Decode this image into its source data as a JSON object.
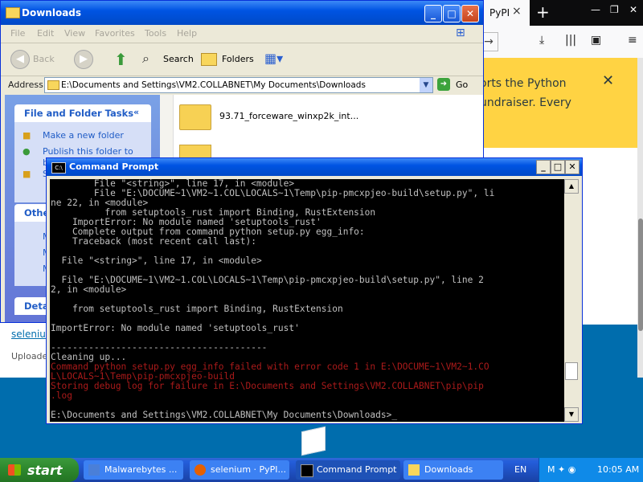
{
  "browser": {
    "tab_label": "PyPI",
    "tab_close": "×",
    "new_tab": "+",
    "win_buttons": [
      "—",
      "❐",
      "✕"
    ],
    "banner_lines": [
      "orts the Python",
      "undraiser. Every"
    ],
    "banner_close": "✕"
  },
  "explorer": {
    "title": "Downloads",
    "menu": [
      "File",
      "Edit",
      "View",
      "Favorites",
      "Tools",
      "Help"
    ],
    "toolbar": {
      "back": "Back",
      "search": "Search",
      "folders": "Folders"
    },
    "address_label": "Address",
    "address_value": "E:\\Documents and Settings\\VM2.COLLABNET\\My Documents\\Downloads",
    "go_label": "Go",
    "panels": {
      "file_tasks_title": "File and Folder Tasks",
      "task1": "Make a new folder",
      "task2": "Publish this folder to",
      "task2b": "b",
      "task3": "S",
      "other_title": "Othe",
      "other_items": [
        "M",
        "M",
        "M"
      ],
      "details_title": "Deta"
    },
    "files": [
      "93.71_forceware_winxp2k_int..."
    ]
  },
  "under": {
    "link": "seleniu",
    "upload": "Uploade"
  },
  "cmd": {
    "title": "Command Prompt",
    "lines_gray": [
      "        File \"<string>\", line 17, in <module>",
      "        File \"E:\\DOCUME~1\\VM2~1.COL\\LOCALS~1\\Temp\\pip-pmcxpjeo-build\\setup.py\", li",
      "ne 22, in <module>",
      "          from setuptools_rust import Binding, RustExtension",
      "    ImportError: No module named 'setuptools_rust'",
      "    Complete output from command python setup.py egg_info:",
      "    Traceback (most recent call last):",
      "",
      "  File \"<string>\", line 17, in <module>",
      "",
      "  File \"E:\\DOCUME~1\\VM2~1.COL\\LOCALS~1\\Temp\\pip-pmcxpjeo-build\\setup.py\", line 2",
      "2, in <module>",
      "",
      "    from setuptools_rust import Binding, RustExtension",
      "",
      "ImportError: No module named 'setuptools_rust'",
      "",
      "----------------------------------------",
      "Cleaning up..."
    ],
    "lines_red": [
      "Command python setup.py egg_info failed with error code 1 in E:\\DOCUME~1\\VM2~1.CO",
      "L\\LOCALS~1\\Temp\\pip-pmcxpjeo-build",
      "Storing debug log for failure in E:\\Documents and Settings\\VM2.COLLABNET\\pip\\pip",
      ".log"
    ],
    "prompt": "E:\\Documents and Settings\\VM2.COLLABNET\\My Documents\\Downloads>_"
  },
  "taskbar": {
    "start": "start",
    "items": [
      "Malwarebytes ...",
      "selenium · PyPI...",
      "Command Prompt",
      "Downloads"
    ],
    "lang": "EN",
    "clock": "10:05 AM"
  }
}
